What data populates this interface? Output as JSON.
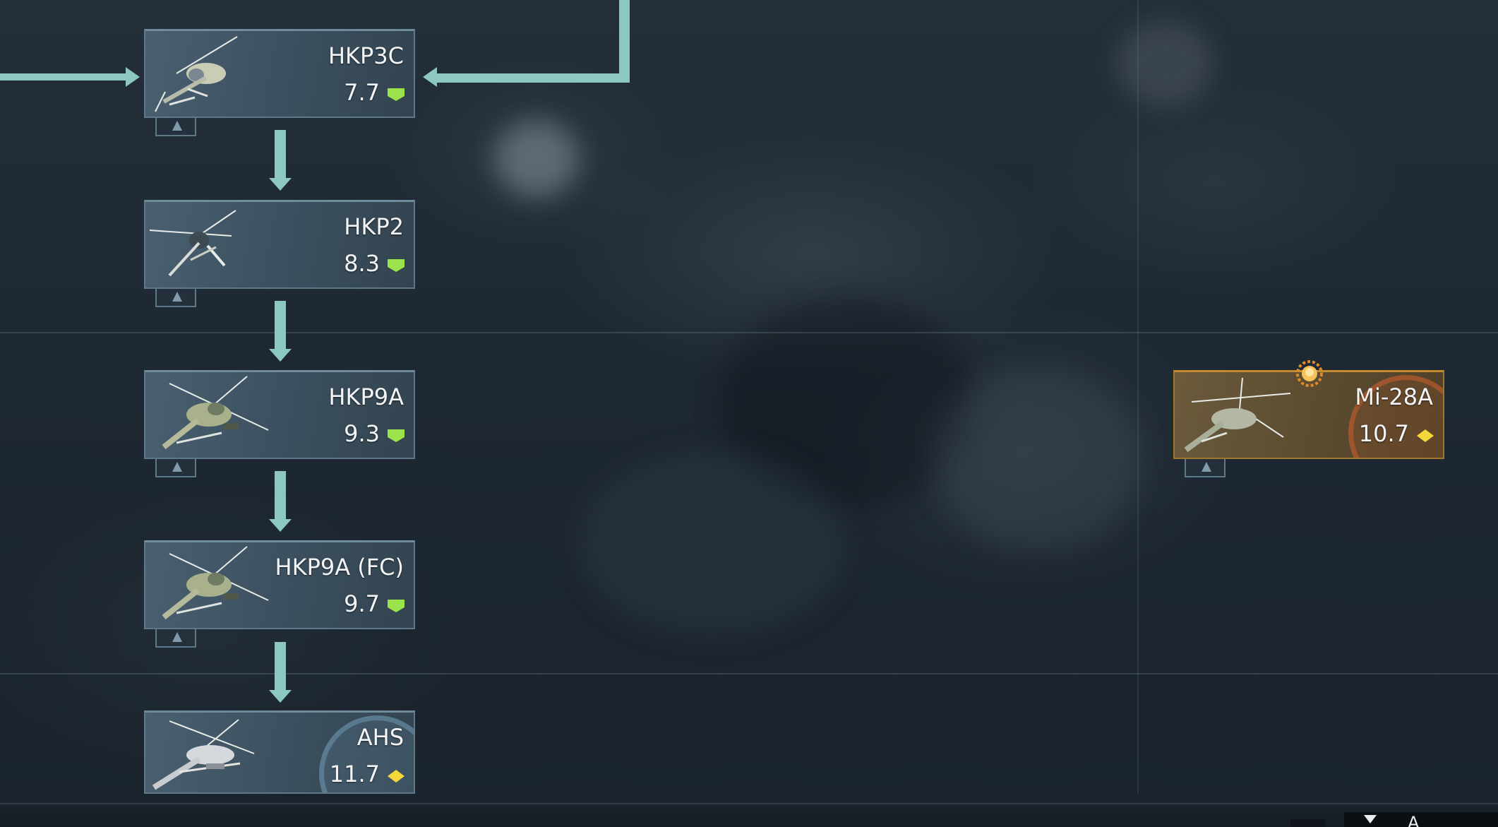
{
  "tech_tree": {
    "vehicles": [
      {
        "id": "hkp3c",
        "name": "HKP3C",
        "battle_rating": "7.7",
        "rank_icon": "green-chevron-icon",
        "premium": false
      },
      {
        "id": "hkp2",
        "name": "HKP2",
        "battle_rating": "8.3",
        "rank_icon": "green-chevron-icon",
        "premium": false
      },
      {
        "id": "hkp9a",
        "name": "HKP9A",
        "battle_rating": "9.3",
        "rank_icon": "green-chevron-icon",
        "premium": false
      },
      {
        "id": "hkp9a_fc",
        "name": "HKP9A (FC)",
        "battle_rating": "9.7",
        "rank_icon": "green-chevron-icon",
        "premium": false
      },
      {
        "id": "ahs",
        "name": "AHS",
        "battle_rating": "11.7",
        "rank_icon": "yellow-diamond-icon",
        "premium": false,
        "nation_emblem": "blue"
      },
      {
        "id": "mi28a",
        "name": "Mi-28A",
        "battle_rating": "10.7",
        "rank_icon": "yellow-diamond-icon",
        "premium": true,
        "nation_emblem": "orange",
        "badge": "gold-medal-icon"
      }
    ]
  },
  "bottom_bar": {
    "hint": "",
    "action_label": "A"
  },
  "colors": {
    "connector": "#8cc7c4",
    "rank_green": "#9be34a",
    "rank_yellow": "#f4d83a",
    "premium_border": "#c48a2e"
  }
}
